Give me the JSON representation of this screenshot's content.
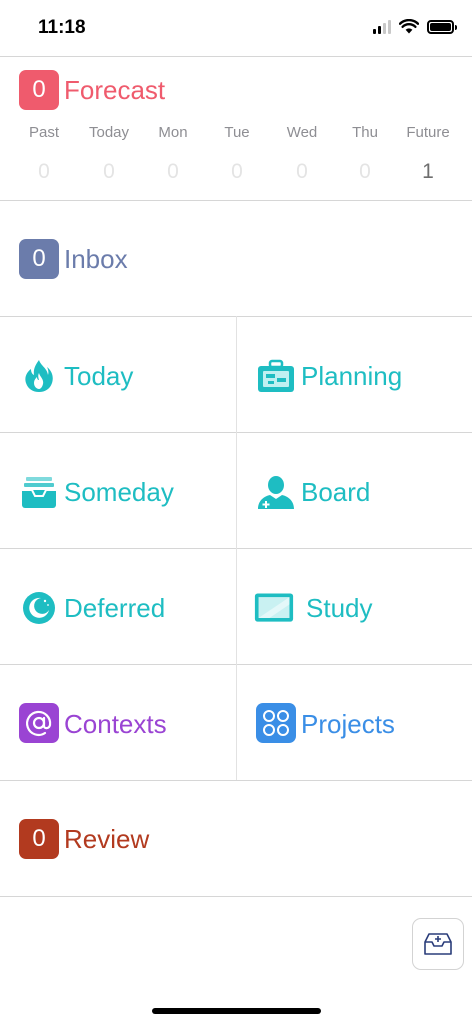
{
  "status": {
    "time": "11:18"
  },
  "forecast": {
    "badge": "0",
    "label": "Forecast",
    "color": "#ef5b6d",
    "days": [
      {
        "name": "Past",
        "count": "0"
      },
      {
        "name": "Today",
        "count": "0"
      },
      {
        "name": "Mon",
        "count": "0"
      },
      {
        "name": "Tue",
        "count": "0"
      },
      {
        "name": "Wed",
        "count": "0"
      },
      {
        "name": "Thu",
        "count": "0"
      },
      {
        "name": "Future",
        "count": "1"
      }
    ]
  },
  "inbox": {
    "badge": "0",
    "label": "Inbox",
    "color": "#6b7cab"
  },
  "grid": [
    {
      "label": "Today",
      "icon": "flame-icon",
      "color": "#1ebdc2"
    },
    {
      "label": "Planning",
      "icon": "briefcase-icon",
      "color": "#1ebdc2"
    },
    {
      "label": "Someday",
      "icon": "inbox-tray-icon",
      "color": "#1ebdc2"
    },
    {
      "label": "Board",
      "icon": "person-icon",
      "color": "#1ebdc2"
    },
    {
      "label": "Deferred",
      "icon": "moon-icon",
      "color": "#1ebdc2"
    },
    {
      "label": "Study",
      "icon": "tablet-icon",
      "color": "#1ebdc2"
    },
    {
      "label": "Contexts",
      "icon": "at-sign-icon",
      "color": "#9a44d3"
    },
    {
      "label": "Projects",
      "icon": "circles-icon",
      "color": "#3a8ee6"
    }
  ],
  "review": {
    "badge": "0",
    "label": "Review",
    "color": "#b23a1f"
  },
  "fab": {
    "icon": "add-to-inbox-icon"
  }
}
